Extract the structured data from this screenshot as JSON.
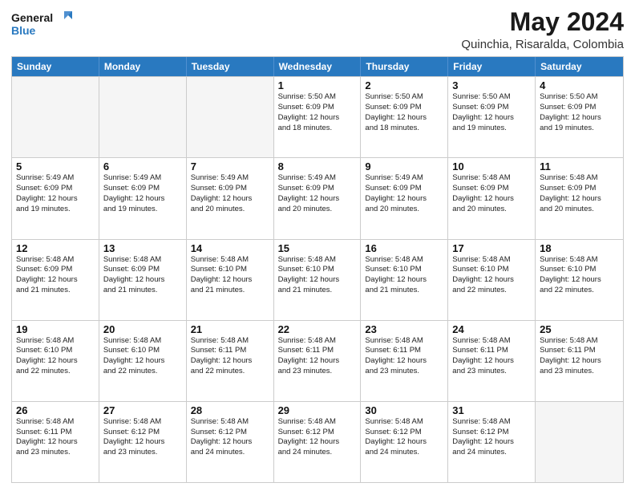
{
  "logo": {
    "line1": "General",
    "line2": "Blue"
  },
  "title": "May 2024",
  "subtitle": "Quinchia, Risaralda, Colombia",
  "header_days": [
    "Sunday",
    "Monday",
    "Tuesday",
    "Wednesday",
    "Thursday",
    "Friday",
    "Saturday"
  ],
  "rows": [
    [
      {
        "day": "",
        "text": "",
        "empty": true
      },
      {
        "day": "",
        "text": "",
        "empty": true
      },
      {
        "day": "",
        "text": "",
        "empty": true
      },
      {
        "day": "1",
        "text": "Sunrise: 5:50 AM\nSunset: 6:09 PM\nDaylight: 12 hours\nand 18 minutes."
      },
      {
        "day": "2",
        "text": "Sunrise: 5:50 AM\nSunset: 6:09 PM\nDaylight: 12 hours\nand 18 minutes."
      },
      {
        "day": "3",
        "text": "Sunrise: 5:50 AM\nSunset: 6:09 PM\nDaylight: 12 hours\nand 19 minutes."
      },
      {
        "day": "4",
        "text": "Sunrise: 5:50 AM\nSunset: 6:09 PM\nDaylight: 12 hours\nand 19 minutes."
      }
    ],
    [
      {
        "day": "5",
        "text": "Sunrise: 5:49 AM\nSunset: 6:09 PM\nDaylight: 12 hours\nand 19 minutes."
      },
      {
        "day": "6",
        "text": "Sunrise: 5:49 AM\nSunset: 6:09 PM\nDaylight: 12 hours\nand 19 minutes."
      },
      {
        "day": "7",
        "text": "Sunrise: 5:49 AM\nSunset: 6:09 PM\nDaylight: 12 hours\nand 20 minutes."
      },
      {
        "day": "8",
        "text": "Sunrise: 5:49 AM\nSunset: 6:09 PM\nDaylight: 12 hours\nand 20 minutes."
      },
      {
        "day": "9",
        "text": "Sunrise: 5:49 AM\nSunset: 6:09 PM\nDaylight: 12 hours\nand 20 minutes."
      },
      {
        "day": "10",
        "text": "Sunrise: 5:48 AM\nSunset: 6:09 PM\nDaylight: 12 hours\nand 20 minutes."
      },
      {
        "day": "11",
        "text": "Sunrise: 5:48 AM\nSunset: 6:09 PM\nDaylight: 12 hours\nand 20 minutes."
      }
    ],
    [
      {
        "day": "12",
        "text": "Sunrise: 5:48 AM\nSunset: 6:09 PM\nDaylight: 12 hours\nand 21 minutes."
      },
      {
        "day": "13",
        "text": "Sunrise: 5:48 AM\nSunset: 6:09 PM\nDaylight: 12 hours\nand 21 minutes."
      },
      {
        "day": "14",
        "text": "Sunrise: 5:48 AM\nSunset: 6:10 PM\nDaylight: 12 hours\nand 21 minutes."
      },
      {
        "day": "15",
        "text": "Sunrise: 5:48 AM\nSunset: 6:10 PM\nDaylight: 12 hours\nand 21 minutes."
      },
      {
        "day": "16",
        "text": "Sunrise: 5:48 AM\nSunset: 6:10 PM\nDaylight: 12 hours\nand 21 minutes."
      },
      {
        "day": "17",
        "text": "Sunrise: 5:48 AM\nSunset: 6:10 PM\nDaylight: 12 hours\nand 22 minutes."
      },
      {
        "day": "18",
        "text": "Sunrise: 5:48 AM\nSunset: 6:10 PM\nDaylight: 12 hours\nand 22 minutes."
      }
    ],
    [
      {
        "day": "19",
        "text": "Sunrise: 5:48 AM\nSunset: 6:10 PM\nDaylight: 12 hours\nand 22 minutes."
      },
      {
        "day": "20",
        "text": "Sunrise: 5:48 AM\nSunset: 6:10 PM\nDaylight: 12 hours\nand 22 minutes."
      },
      {
        "day": "21",
        "text": "Sunrise: 5:48 AM\nSunset: 6:11 PM\nDaylight: 12 hours\nand 22 minutes."
      },
      {
        "day": "22",
        "text": "Sunrise: 5:48 AM\nSunset: 6:11 PM\nDaylight: 12 hours\nand 23 minutes."
      },
      {
        "day": "23",
        "text": "Sunrise: 5:48 AM\nSunset: 6:11 PM\nDaylight: 12 hours\nand 23 minutes."
      },
      {
        "day": "24",
        "text": "Sunrise: 5:48 AM\nSunset: 6:11 PM\nDaylight: 12 hours\nand 23 minutes."
      },
      {
        "day": "25",
        "text": "Sunrise: 5:48 AM\nSunset: 6:11 PM\nDaylight: 12 hours\nand 23 minutes."
      }
    ],
    [
      {
        "day": "26",
        "text": "Sunrise: 5:48 AM\nSunset: 6:11 PM\nDaylight: 12 hours\nand 23 minutes."
      },
      {
        "day": "27",
        "text": "Sunrise: 5:48 AM\nSunset: 6:12 PM\nDaylight: 12 hours\nand 23 minutes."
      },
      {
        "day": "28",
        "text": "Sunrise: 5:48 AM\nSunset: 6:12 PM\nDaylight: 12 hours\nand 24 minutes."
      },
      {
        "day": "29",
        "text": "Sunrise: 5:48 AM\nSunset: 6:12 PM\nDaylight: 12 hours\nand 24 minutes."
      },
      {
        "day": "30",
        "text": "Sunrise: 5:48 AM\nSunset: 6:12 PM\nDaylight: 12 hours\nand 24 minutes."
      },
      {
        "day": "31",
        "text": "Sunrise: 5:48 AM\nSunset: 6:12 PM\nDaylight: 12 hours\nand 24 minutes."
      },
      {
        "day": "",
        "text": "",
        "empty": true
      }
    ]
  ]
}
